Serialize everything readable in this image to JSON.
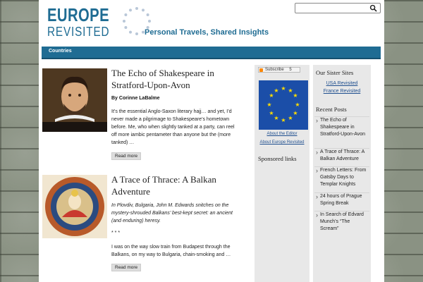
{
  "site": {
    "logo_line1": "EUROPE",
    "logo_line2": "REVISITED",
    "tagline": "Personal Travels, Shared Insights"
  },
  "search": {
    "placeholder": ""
  },
  "nav": {
    "items": [
      "Countries"
    ]
  },
  "posts": [
    {
      "title": "The Echo of Shakespeare in Stratford-Upon-Avon",
      "byline": "By Corinne LaBalme",
      "excerpt": "It’s the essential Anglo-Saxon literary hajj… and yet, I’d never made a pilgrimage to Shakespeare’s hometown before. Me, who when slightly tanked at a party, can reel off more iambic pentameter than anyone but the (more tanked) …",
      "read_more": "Read more"
    },
    {
      "title": "A Trace of Thrace: A Balkan Adventure",
      "intro": "In Plovdiv, Bulgaria, John M. Edwards snitches on the mystery-shrouded Balkans’ best-kept secret: an ancient (and enduring) heresy.",
      "separator": "* * *",
      "excerpt": "I was on the way slow train from Budapest through the Balkans, on my way to Bulgaria, chain-smoking and …",
      "read_more": "Read more"
    }
  ],
  "sidebar_mid": {
    "subscribe_label": "Subscribe",
    "subscribe_count": "5",
    "about_editor": "About the Editor",
    "about_site": "About Europe Revisited",
    "sponsored": "Sponsored links"
  },
  "sidebar_right": {
    "sister_heading": "Our Sister Sites",
    "sister_links": [
      "USA Revisited",
      "France Revisited"
    ],
    "recent_heading": "Recent Posts",
    "recent_posts": [
      "The Echo of Shakespeare in Stratford-Upon-Avon",
      "A Trace of Thrace: A Balkan Adventure",
      "French Letters: From Gatsby Days to Templar Knights",
      "24 hours of Prague Spring Break",
      "In Search of Edvard Munch’s “The Scream”"
    ]
  },
  "colors": {
    "brand": "#1f6c93",
    "flag_blue": "#1b4ea8",
    "flag_star": "#ffdd00"
  }
}
